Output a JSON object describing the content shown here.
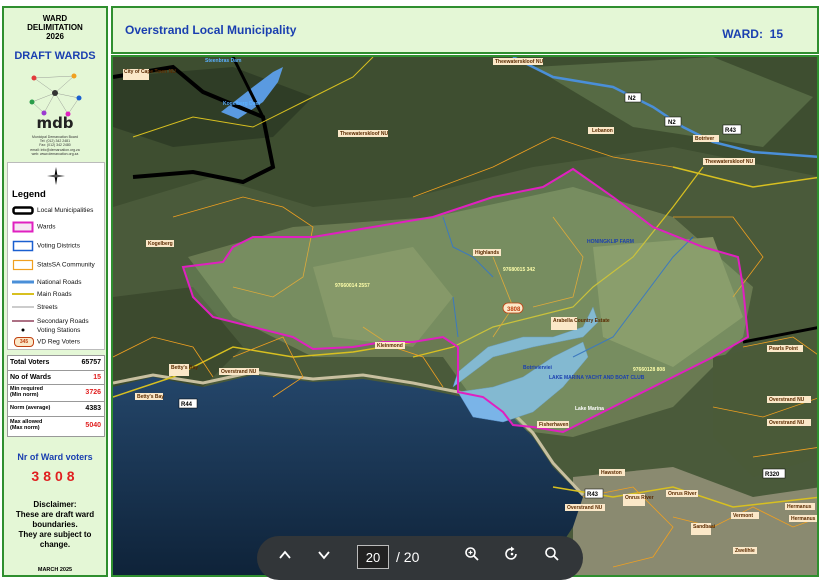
{
  "sidebar": {
    "title_lines": [
      "WARD",
      "DELIMITATION",
      "2026"
    ],
    "draft_title": "DRAFT WARDS",
    "logo_text": "mdb",
    "logo_small": [
      "Municipal Demarcation Board",
      "Tel: (012) 342 2481",
      "Fax: (012) 342 2480",
      "email: info@demarcation.org.za",
      "web: www.demarcation.org.za"
    ],
    "legend": {
      "title": "Legend",
      "items": [
        {
          "label": "Local Municipalities",
          "swatch": "thick-black-outline"
        },
        {
          "label": "Wards",
          "swatch": "magenta-outline"
        },
        {
          "label": "Voting Districts",
          "swatch": "blue-outline"
        },
        {
          "label": "StatsSA Community",
          "swatch": "orange-outline"
        },
        {
          "label": "National Roads",
          "swatch": "blue-line"
        },
        {
          "label": "Main Roads",
          "swatch": "yellow-line"
        },
        {
          "label": "Streets",
          "swatch": "grey-line"
        },
        {
          "label": "Secondary Roads",
          "swatch": "dark-red-line"
        },
        {
          "label": "Voting Stations",
          "swatch": "dot"
        },
        {
          "label": "VD Reg Voters",
          "swatch": "number-badge",
          "badge": "345"
        }
      ]
    },
    "stats": [
      {
        "label": "Total Voters",
        "value": "65757"
      },
      {
        "label": "No of Wards",
        "value": "15"
      },
      {
        "label": "Min required\n(Min norm)",
        "value": "3726"
      },
      {
        "label": "Norm (average)",
        "value": "4383"
      },
      {
        "label": "Max allowed\n(Max norm)",
        "value": "5040"
      }
    ],
    "nr_voters_label": "Nr of Ward voters",
    "nr_voters_value": "3808",
    "disclaimer": "Disclaimer:\nThese are draft ward boundaries.\nThey are subject to change.",
    "date": "MARCH 2025"
  },
  "header": {
    "municipality": "Overstrand Local Municipality",
    "ward_label": "WARD:",
    "ward_number": "15"
  },
  "map": {
    "labels": [
      "City of Cape Town NU",
      "Theewaterskloof NU",
      "Theewaterskloof NU",
      "Lebanon",
      "Theewaterskloof NU",
      "Kogelberg",
      "Highlands",
      "97660014 2557",
      "97680015 342",
      "Arabella Country Estate",
      "HONINGKLIP FARM",
      "3808",
      "Kleinmond",
      "Betty's Bay",
      "Overstrand NU",
      "Betty's Bay",
      "Botrivierviei",
      "LAKE MARINA YACHT AND BOAT CLUB",
      "97660128 808",
      "Lake Marina",
      "Fisherhaven",
      "Hawston",
      "Overstrand NU",
      "Onrus River",
      "Onrus River",
      "Vermont",
      "Sandbaai",
      "Hermanus",
      "Hermanus",
      "Zwelihle",
      "Overstrand NU",
      "Overstrand NU",
      "Pearls Point",
      "Botriver",
      "Steenbras Dam",
      "Kogelberg Dam"
    ],
    "road_badges": [
      "N2",
      "N2",
      "R43",
      "R44",
      "R43",
      "R320"
    ]
  },
  "toolbar": {
    "page_current": "20",
    "page_total": "/ 20"
  },
  "colors": {
    "ward_boundary": "#e020c0",
    "municipal_boundary": "#000000",
    "voting_district": "#1a5fd0",
    "community": "#f0a020",
    "panel_bg": "#e4f7d6",
    "panel_border": "#2f8f2f",
    "title_blue": "#1a3fb0"
  }
}
